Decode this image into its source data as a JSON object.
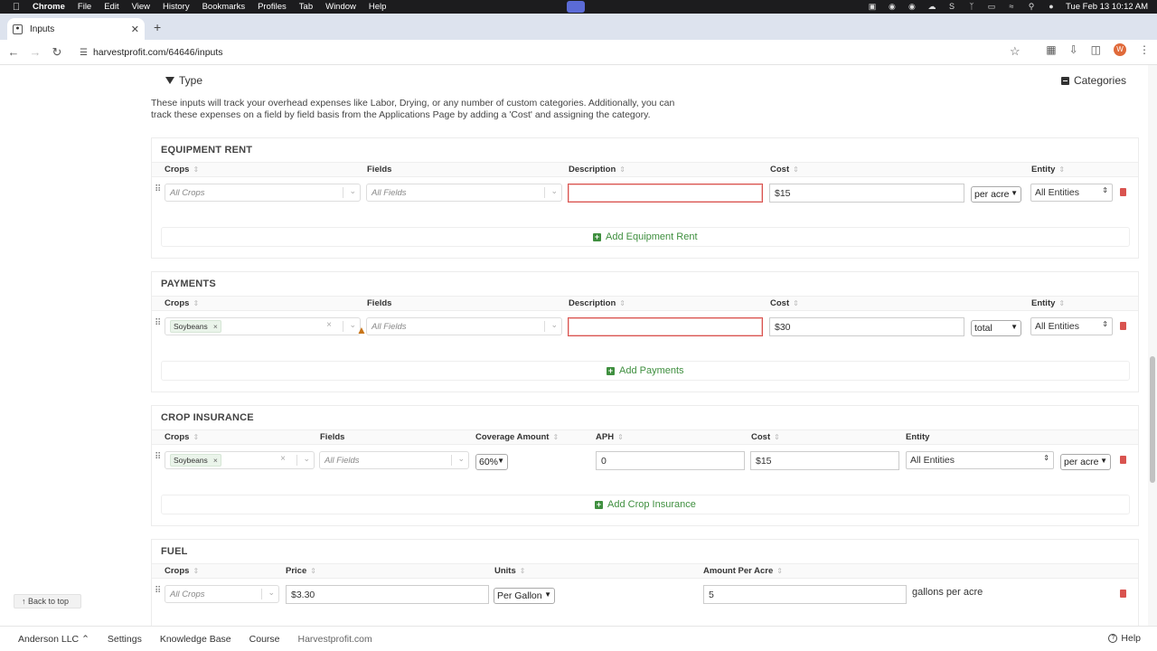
{
  "menubar": {
    "app": "Chrome",
    "items": [
      "File",
      "Edit",
      "View",
      "History",
      "Bookmarks",
      "Profiles",
      "Tab",
      "Window",
      "Help"
    ],
    "clock": "Tue Feb 13  10:12 AM"
  },
  "browser": {
    "tab_title": "Inputs",
    "url": "harvestprofit.com/64646/inputs",
    "avatar_letter": "W"
  },
  "toolbar": {
    "type_label": "Type",
    "categories_label": "Categories"
  },
  "intro_text": "These inputs will track your overhead expenses like Labor, Drying, or any number of custom categories. Additionally, you can track these expenses on a field by field basis from the Applications Page by adding a 'Cost' and assigning the category.",
  "equipment_rent": {
    "title": "EQUIPMENT RENT",
    "headers": {
      "crops": "Crops",
      "fields": "Fields",
      "description": "Description",
      "cost": "Cost",
      "entity": "Entity"
    },
    "row": {
      "crops_placeholder": "All Crops",
      "fields_placeholder": "All Fields",
      "cost": "$15",
      "unit": "per acre",
      "entity": "All Entities"
    },
    "add_label": "Add Equipment Rent"
  },
  "payments": {
    "title": "PAYMENTS",
    "headers": {
      "crops": "Crops",
      "fields": "Fields",
      "description": "Description",
      "cost": "Cost",
      "entity": "Entity"
    },
    "row": {
      "crop_chip": "Soybeans",
      "fields_placeholder": "All Fields",
      "cost": "$30",
      "unit": "total",
      "entity": "All Entities"
    },
    "add_label": "Add Payments"
  },
  "crop_insurance": {
    "title": "CROP INSURANCE",
    "headers": {
      "crops": "Crops",
      "fields": "Fields",
      "coverage": "Coverage Amount",
      "aph": "APH",
      "cost": "Cost",
      "entity": "Entity"
    },
    "row": {
      "crop_chip": "Soybeans",
      "fields_placeholder": "All Fields",
      "coverage": "60%",
      "aph": "0",
      "cost": "$15",
      "entity": "All Entities",
      "unit": "per acre"
    },
    "add_label": "Add Crop Insurance"
  },
  "fuel": {
    "title": "FUEL",
    "headers": {
      "crops": "Crops",
      "price": "Price",
      "units": "Units",
      "amount": "Amount Per Acre"
    },
    "row": {
      "crops_placeholder": "All Crops",
      "price": "$3.30",
      "units": "Per Gallon",
      "amount": "5",
      "amount_unit": "gallons per acre"
    }
  },
  "back_to_top": "Back to top",
  "footer": {
    "org": "Anderson LLC",
    "links": [
      "Settings",
      "Knowledge Base",
      "Course",
      "Harvestprofit.com"
    ],
    "help": "Help"
  },
  "colors": {
    "accent_green": "#3f8f3f",
    "error_red": "#d9534f",
    "trash_red": "#d9534f"
  }
}
